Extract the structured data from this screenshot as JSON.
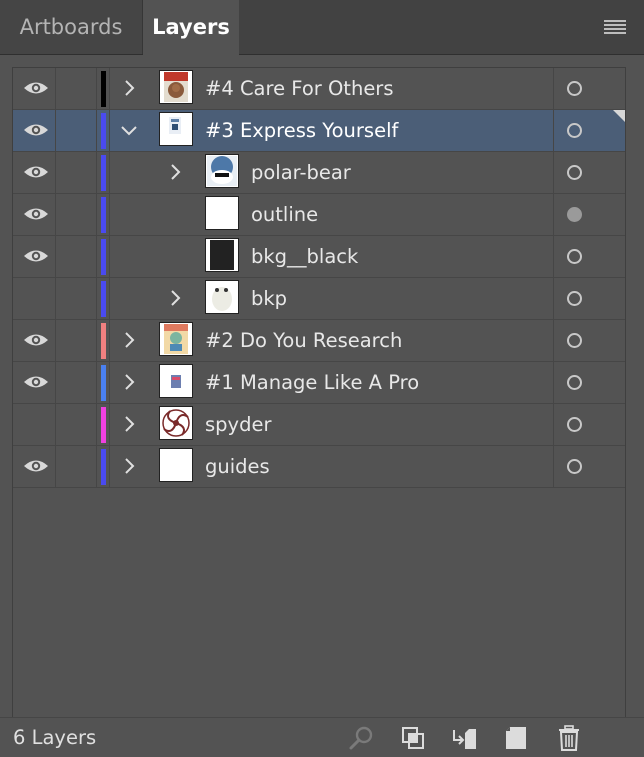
{
  "tabs": [
    {
      "label": "Artboards",
      "active": false
    },
    {
      "label": "Layers",
      "active": true
    }
  ],
  "menu_icon": "hamburger-icon",
  "layers": [
    {
      "name": "#4 Care For Others",
      "visible": true,
      "color": "#000000",
      "expandable": true,
      "expanded": false,
      "indent": 0,
      "thumb": "care",
      "target_filled": false,
      "selected": false
    },
    {
      "name": "#3 Express Yourself",
      "visible": true,
      "color": "#4a4af0",
      "expandable": true,
      "expanded": true,
      "indent": 0,
      "thumb": "express",
      "target_filled": false,
      "selected": true
    },
    {
      "name": "polar-bear",
      "visible": true,
      "color": "#4a4af0",
      "expandable": true,
      "expanded": false,
      "indent": 1,
      "thumb": "polar",
      "target_filled": false,
      "selected": false
    },
    {
      "name": "outline",
      "visible": true,
      "color": "#4a4af0",
      "expandable": false,
      "expanded": false,
      "indent": 1,
      "thumb": "white",
      "target_filled": true,
      "selected": false
    },
    {
      "name": "bkg__black",
      "visible": true,
      "color": "#4a4af0",
      "expandable": false,
      "expanded": false,
      "indent": 1,
      "thumb": "black",
      "target_filled": false,
      "selected": false
    },
    {
      "name": "bkp",
      "visible": false,
      "color": "#4a4af0",
      "expandable": true,
      "expanded": false,
      "indent": 1,
      "thumb": "bkp",
      "target_filled": false,
      "selected": false
    },
    {
      "name": "#2 Do You Research",
      "visible": true,
      "color": "#f08080",
      "expandable": true,
      "expanded": false,
      "indent": 0,
      "thumb": "research",
      "target_filled": false,
      "selected": false
    },
    {
      "name": "#1 Manage Like A Pro",
      "visible": true,
      "color": "#4a80f0",
      "expandable": true,
      "expanded": false,
      "indent": 0,
      "thumb": "manage",
      "target_filled": false,
      "selected": false
    },
    {
      "name": "spyder",
      "visible": false,
      "color": "#f040e0",
      "expandable": true,
      "expanded": false,
      "indent": 0,
      "thumb": "spyder",
      "target_filled": false,
      "selected": false
    },
    {
      "name": "guides",
      "visible": true,
      "color": "#4a4af0",
      "expandable": true,
      "expanded": false,
      "indent": 0,
      "thumb": "white",
      "target_filled": false,
      "selected": false
    }
  ],
  "footer": {
    "count_label": "6 Layers",
    "buttons": [
      {
        "icon": "locate-object-search-icon"
      },
      {
        "icon": "make-clipping-mask-icon"
      },
      {
        "icon": "create-sublayer-icon"
      },
      {
        "icon": "create-new-layer-icon"
      },
      {
        "icon": "delete-trash-icon"
      }
    ]
  }
}
